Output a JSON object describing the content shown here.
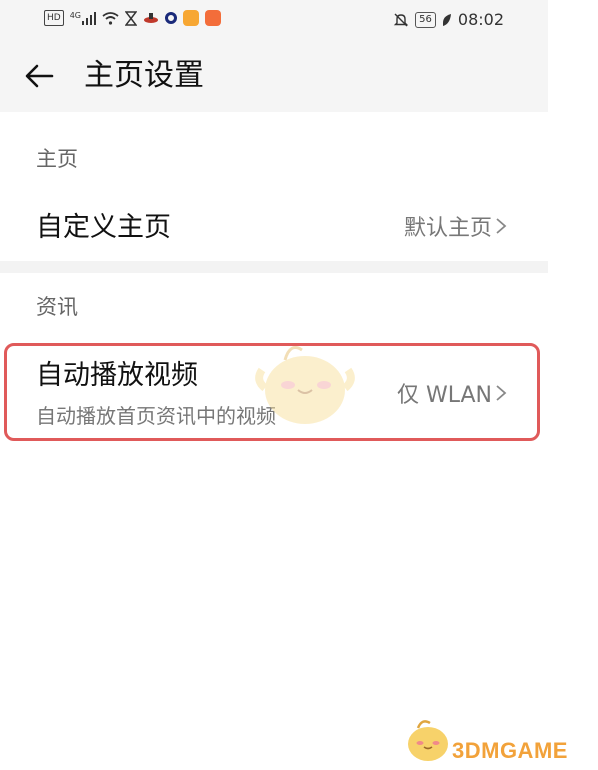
{
  "status_bar": {
    "hd_badge": "HD",
    "network": "4G",
    "time": "08:02",
    "battery": "56",
    "icons": [
      "hd-icon",
      "signal-icon",
      "wifi-icon",
      "hourglass-icon",
      "app-icon",
      "ring-app-icon",
      "orange-app-icon",
      "message-app-icon",
      "bell-mute-icon",
      "battery-icon",
      "leaf-icon"
    ]
  },
  "header": {
    "title": "主页设置",
    "back_icon": "arrow-left-icon"
  },
  "sections": {
    "home": {
      "label": "主页",
      "custom_home": {
        "title": "自定义主页",
        "value": "默认主页"
      }
    },
    "news": {
      "label": "资讯",
      "autoplay": {
        "title": "自动播放视频",
        "subtitle": "自动播放首页资讯中的视频",
        "value": "仅 WLAN"
      }
    }
  },
  "watermark": {
    "text": "3DMGAME"
  },
  "colors": {
    "highlight": "#e05a5a",
    "bar_bg": "#f5f5f5",
    "watermark": "#f2a23a"
  }
}
